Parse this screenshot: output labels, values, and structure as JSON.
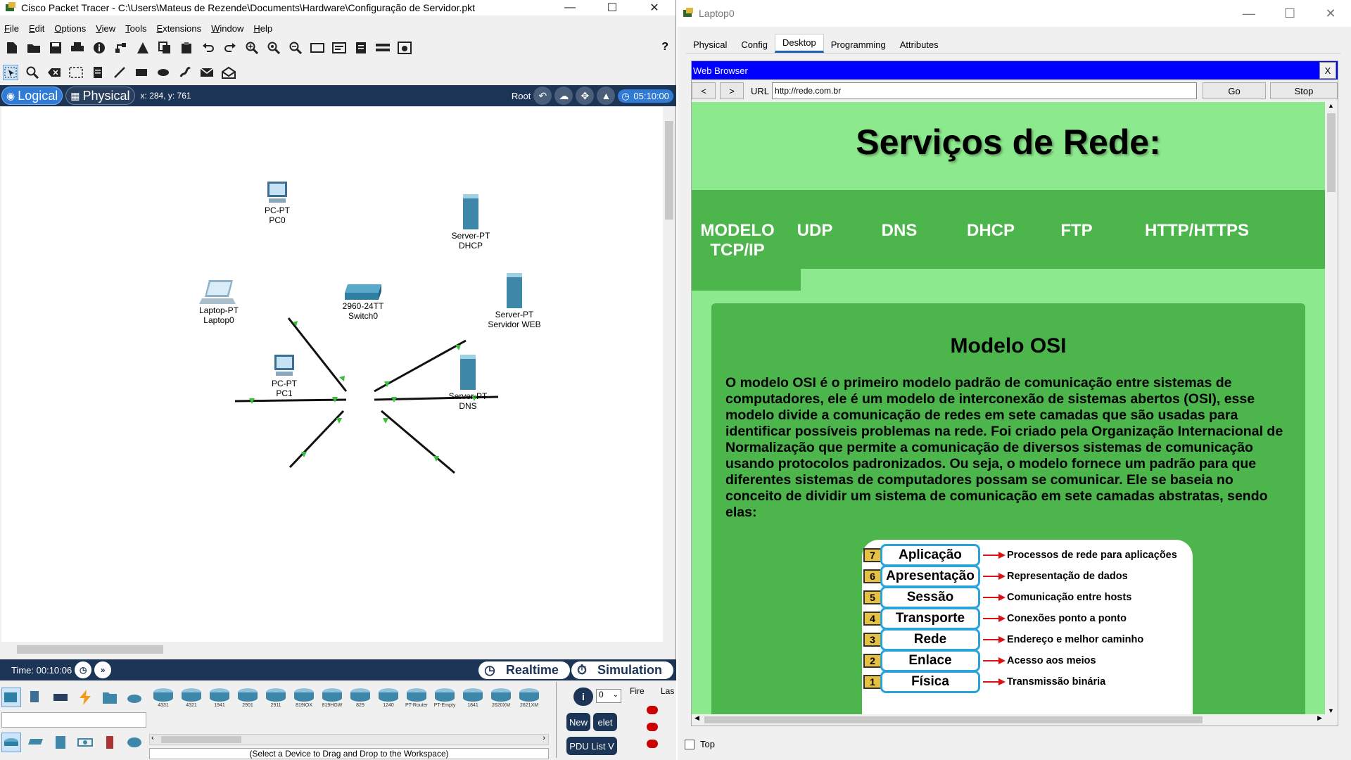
{
  "packet_tracer": {
    "window_title": "Cisco Packet Tracer - C:\\Users\\Mateus de Rezende\\Documents\\Hardware\\Configuração de Servidor.pkt",
    "menu": [
      "File",
      "Edit",
      "Options",
      "View",
      "Tools",
      "Extensions",
      "Window",
      "Help"
    ],
    "help_icon": "?",
    "modes": {
      "logical": "Logical",
      "physical": "Physical"
    },
    "coords": "x: 284, y: 761",
    "root_label": "Root",
    "clock": "05:10:00",
    "time_label": "Time: 00:10:06",
    "realtime": "Realtime",
    "simulation": "Simulation",
    "devices": [
      {
        "name": "PC0",
        "type": "PC-PT",
        "icon": "pc-icon"
      },
      {
        "name": "DHCP",
        "type": "Server-PT",
        "icon": "server-icon"
      },
      {
        "name": "Laptop0",
        "type": "Laptop-PT",
        "icon": "laptop-icon"
      },
      {
        "name": "Switch0",
        "type": "2960-24TT",
        "icon": "switch-icon"
      },
      {
        "name": "Servidor WEB",
        "type": "Server-PT",
        "icon": "server-icon"
      },
      {
        "name": "PC1",
        "type": "PC-PT",
        "icon": "pc-icon"
      },
      {
        "name": "DNS",
        "type": "Server-PT",
        "icon": "server-icon"
      }
    ],
    "device_models": [
      "4331",
      "4321",
      "1941",
      "2901",
      "2911",
      "819IOX",
      "819HGW",
      "829",
      "1240",
      "PT-Router",
      "PT-Empty",
      "1841",
      "2620XM",
      "2621XM"
    ],
    "device_hint": "(Select a Device to Drag and Drop to the Workspace)",
    "pdu": {
      "select_value": "0",
      "new": "New",
      "delete": "elet",
      "list": "PDU List V",
      "col_fire": "Fire",
      "col_last": "Las"
    }
  },
  "laptop": {
    "window_title": "Laptop0",
    "tabs": [
      "Physical",
      "Config",
      "Desktop",
      "Programming",
      "Attributes"
    ],
    "selected_tab": "Desktop",
    "browser": {
      "title": "Web Browser",
      "close": "X",
      "back": "<",
      "forward": ">",
      "url_label": "URL",
      "url": "http://rede.com.br",
      "go": "Go",
      "stop": "Stop"
    },
    "site": {
      "title": "Serviços de Rede:",
      "nav": [
        "MODELO TCP/IP",
        "UDP",
        "DNS",
        "DHCP",
        "FTP",
        "HTTP/HTTPS"
      ],
      "heading": "Modelo OSI",
      "body": "O modelo OSI é o primeiro modelo padrão de comunicação entre sistemas de computadores, ele é um modelo de interconexão de sistemas abertos (OSI), esse modelo divide a comunicação de redes em sete camadas que são usadas para identificar possíveis problemas na rede. Foi criado pela Organização Internacional de Normalização que permite a comunicação de diversos sistemas de comunicação usando protocolos padronizados. Ou seja, o modelo fornece um padrão para que diferentes sistemas de computadores possam se comunicar. Ele se baseia no conceito de dividir um sistema de comunicação em sete camadas abstratas, sendo elas:",
      "osi_layers": [
        {
          "num": "7",
          "name": "Aplicação",
          "desc": "Processos de rede para aplicações"
        },
        {
          "num": "6",
          "name": "Apresentação",
          "desc": "Representação de dados"
        },
        {
          "num": "5",
          "name": "Sessão",
          "desc": "Comunicação entre hosts"
        },
        {
          "num": "4",
          "name": "Transporte",
          "desc": "Conexões ponto a ponto"
        },
        {
          "num": "3",
          "name": "Rede",
          "desc": "Endereço e melhor caminho"
        },
        {
          "num": "2",
          "name": "Enlace",
          "desc": "Acesso aos meios"
        },
        {
          "num": "1",
          "name": "Física",
          "desc": "Transmissão binária"
        }
      ]
    },
    "top_checkbox": "Top"
  }
}
